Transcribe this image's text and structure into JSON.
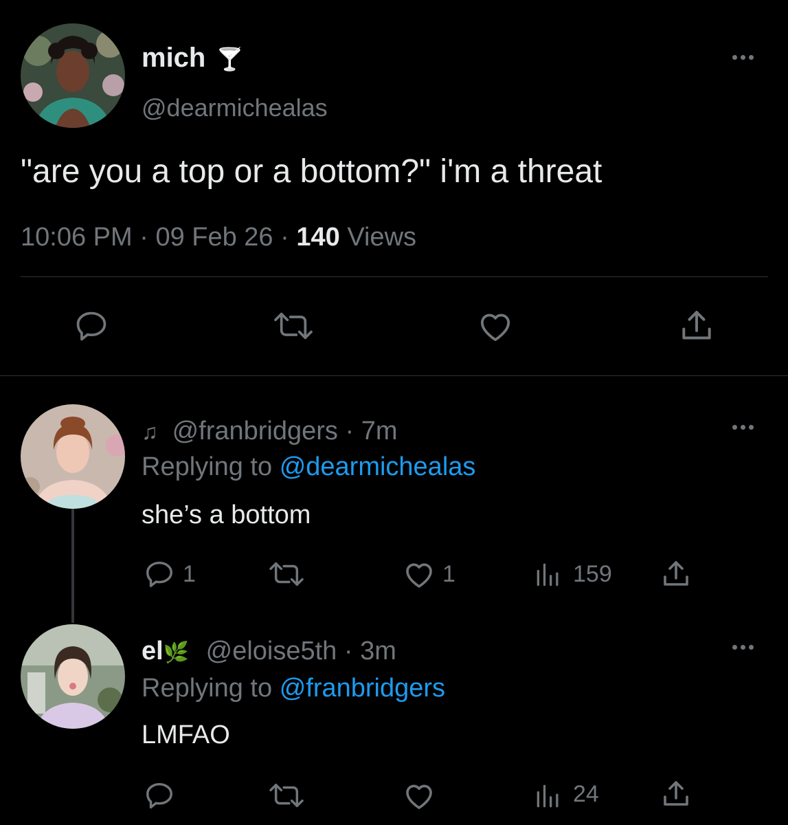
{
  "main_tweet": {
    "display_name": "mich",
    "name_emoji": "🍸",
    "handle": "@dearmichealas",
    "text": "\"are you a top or a bottom?\" i'm a threat",
    "time": "10:06 PM",
    "dot1": "·",
    "date": "09 Feb 26",
    "dot2": "·",
    "views_count": "140",
    "views_label": "Views"
  },
  "reply1": {
    "emoji": "♫",
    "handle": "@franbridgers",
    "sep": "·",
    "time": "7m",
    "replying_prefix": "Replying to",
    "replying_handle": "@dearmichealas",
    "text": "she’s a bottom",
    "reply_count": "1",
    "like_count": "1",
    "views_count": "159"
  },
  "reply2": {
    "display_name": "el",
    "name_emoji": "🌿",
    "handle": "@eloise5th",
    "sep": "·",
    "time": "3m",
    "replying_prefix": "Replying to",
    "replying_handle": "@franbridgers",
    "text": "LMFAO",
    "views_count": "24"
  },
  "colors": {
    "background": "#000000",
    "text": "#e7e9ea",
    "muted": "#71767b",
    "link": "#1d9bf0",
    "divider": "#2f3336"
  },
  "icons": [
    "reply-icon",
    "retweet-icon",
    "like-icon",
    "share-icon",
    "views-icon",
    "more-icon"
  ]
}
